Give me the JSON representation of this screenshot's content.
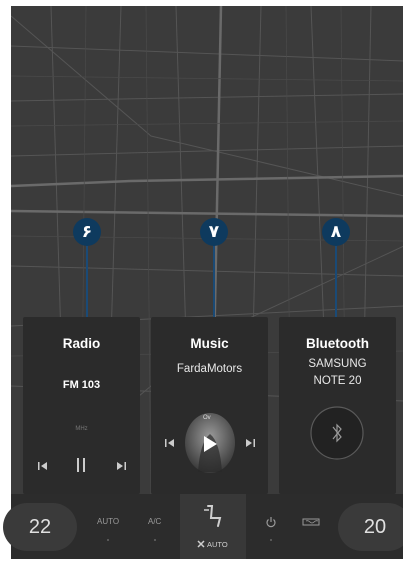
{
  "callouts": [
    "۶",
    "۷",
    "۸"
  ],
  "radio": {
    "title": "Radio",
    "station": "FM 103",
    "unit": "MHz"
  },
  "music": {
    "title": "Music",
    "source": "FardaMotors",
    "art_label": "Ov"
  },
  "bluetooth": {
    "title": "Bluetooth",
    "device_line1": "SAMSUNG",
    "device_line2": "NOTE 20"
  },
  "climate": {
    "temp_left": "22",
    "temp_right": "20",
    "auto_label": "AUTO",
    "ac_label": "A/C",
    "seat_auto_label": "AUTO"
  },
  "icons": {
    "prev": "skip-previous-icon",
    "pause": "pause-icon",
    "next": "skip-next-icon",
    "play": "play-icon",
    "bluetooth": "bluetooth-icon",
    "seat": "seat-icon",
    "fan": "fan-icon",
    "power": "power-icon",
    "defrost": "rear-defrost-icon"
  },
  "colors": {
    "callout_bg": "#0e3a5e",
    "card_bg": "#2b2b2b",
    "screen_bg": "#3a3a3a"
  }
}
